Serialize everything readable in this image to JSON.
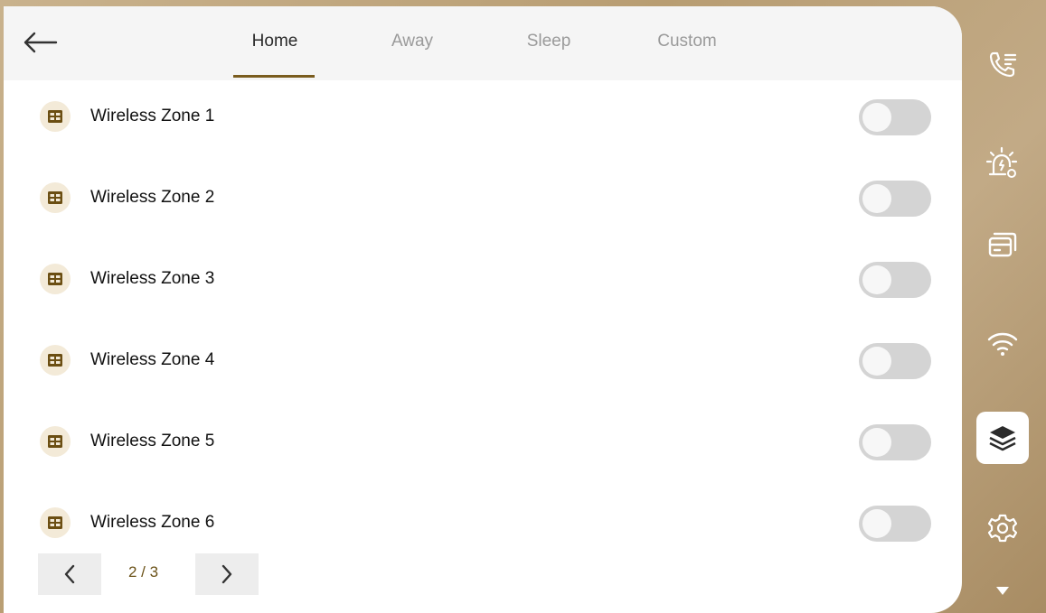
{
  "header": {
    "tabs": [
      {
        "label": "Home"
      },
      {
        "label": "Away"
      },
      {
        "label": "Sleep"
      },
      {
        "label": "Custom"
      }
    ],
    "active_tab": "Home"
  },
  "zones": [
    {
      "label": "Wireless Zone 1",
      "enabled": false
    },
    {
      "label": "Wireless Zone 2",
      "enabled": false
    },
    {
      "label": "Wireless Zone 3",
      "enabled": false
    },
    {
      "label": "Wireless Zone 4",
      "enabled": false
    },
    {
      "label": "Wireless Zone 5",
      "enabled": false
    },
    {
      "label": "Wireless Zone 6",
      "enabled": false
    }
  ],
  "pagination": {
    "text": "2 / 3"
  },
  "sidebar": {
    "items": [
      {
        "icon": "call-log-icon"
      },
      {
        "icon": "alarm-settings-icon"
      },
      {
        "icon": "cards-icon"
      },
      {
        "icon": "wifi-icon"
      },
      {
        "icon": "layers-icon",
        "active": true
      },
      {
        "icon": "gear-icon"
      },
      {
        "icon": "chevron-down-icon"
      }
    ]
  },
  "colors": {
    "accent": "#7a5c1e",
    "toggle_off": "#d4d4d4",
    "zone_icon_bg": "#f3ead8",
    "zone_icon_fg": "#6b4e12"
  }
}
